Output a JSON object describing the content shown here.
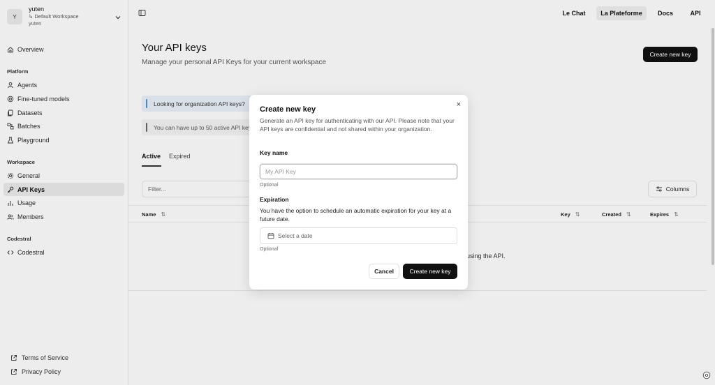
{
  "workspace": {
    "avatar_letter": "Y",
    "name": "yuten",
    "sub": "↳ Default Workspace",
    "user": "yuten"
  },
  "sidebar": {
    "overview": "Overview",
    "platform_section": "Platform",
    "platform_items": [
      {
        "label": "Agents",
        "icon": "user-icon"
      },
      {
        "label": "Fine-tuned models",
        "icon": "model-icon"
      },
      {
        "label": "Datasets",
        "icon": "files-icon"
      },
      {
        "label": "Batches",
        "icon": "batches-icon"
      },
      {
        "label": "Playground",
        "icon": "flask-icon"
      }
    ],
    "workspace_section": "Workspace",
    "workspace_items": [
      {
        "label": "General",
        "icon": "gear-icon"
      },
      {
        "label": "API Keys",
        "icon": "key-icon",
        "active": true
      },
      {
        "label": "Usage",
        "icon": "bar-chart-icon"
      },
      {
        "label": "Members",
        "icon": "users-icon"
      }
    ],
    "codestral_section": "Codestral",
    "codestral_item": "Codestral",
    "footer": {
      "terms": "Terms of Service",
      "privacy": "Privacy Policy"
    }
  },
  "topnav": {
    "le_chat": "Le Chat",
    "la_plateforme": "La Plateforme",
    "docs": "Docs",
    "api": "API"
  },
  "page": {
    "title": "Your API keys",
    "subtitle": "Manage your personal API Keys for your current workspace",
    "create_button": "Create new key",
    "info_org": "Looking for organization API keys?",
    "info_limit": "You can have up to 50 active API keys",
    "tabs": {
      "active": "Active",
      "expired": "Expired"
    },
    "filter_placeholder": "Filter...",
    "columns_button": "Columns",
    "table_headers": {
      "name": "Name",
      "key": "Key",
      "created": "Created",
      "expires": "Expires"
    },
    "empty_text": "using the API."
  },
  "modal": {
    "title": "Create new key",
    "description": "Generate an API key for authenticating with our API. Please note that your API keys are confidential and not shared within your organization.",
    "key_name_label": "Key name",
    "key_name_placeholder": "My API Key",
    "optional": "Optional",
    "expiration_label": "Expiration",
    "expiration_desc": "You have the option to schedule an automatic expiration for your key at a future date.",
    "date_placeholder": "Select a date",
    "cancel": "Cancel",
    "create": "Create new key",
    "close": "×"
  },
  "colors": {
    "accent": "#111111",
    "info_bar": "#4a8fd8",
    "active_nav": "#e7e7e7"
  }
}
